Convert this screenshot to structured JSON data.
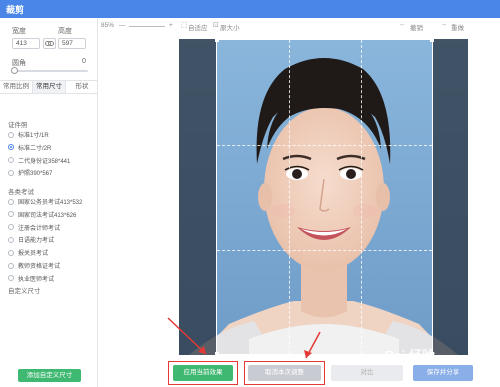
{
  "window": {
    "title": "裁剪"
  },
  "size": {
    "width_label": "宽度",
    "height_label": "高度",
    "width_value": "413",
    "height_value": "597"
  },
  "corner_radius": {
    "label": "圆角",
    "value": "0"
  },
  "tabs": [
    "常用比例",
    "常用尺寸",
    "形状"
  ],
  "groups": [
    {
      "title": "证件照",
      "items": [
        "标准1寸/1R",
        "标准二寸/2R",
        "二代身份证358*441",
        "护照390*567"
      ],
      "checked_index": 1
    },
    {
      "title": "各类考试",
      "items": [
        "国家公务员考试413*532",
        "国家司法考试413*626",
        "注册会计师考试",
        "日语能力考试",
        "报关员考试",
        "教师资格证考试",
        "执业医师考试"
      ],
      "checked_index": -1
    }
  ],
  "custom_size_label": "自定义尺寸",
  "add_custom_button": "添加自定义尺寸",
  "toolbar": {
    "zoom": "85%",
    "minus": "—",
    "plus": "+",
    "fit": "自适应",
    "original": "原大小",
    "undo": "撤销",
    "redo": "重做"
  },
  "actions": {
    "apply": "应用当前效果",
    "cancel": "取消本次调整",
    "compare": "对比",
    "save": "保存并分享"
  },
  "watermark": "Bai 经验",
  "colors": {
    "accent": "#4a86e8",
    "green": "#3fb871",
    "highlight": "#e53935"
  }
}
